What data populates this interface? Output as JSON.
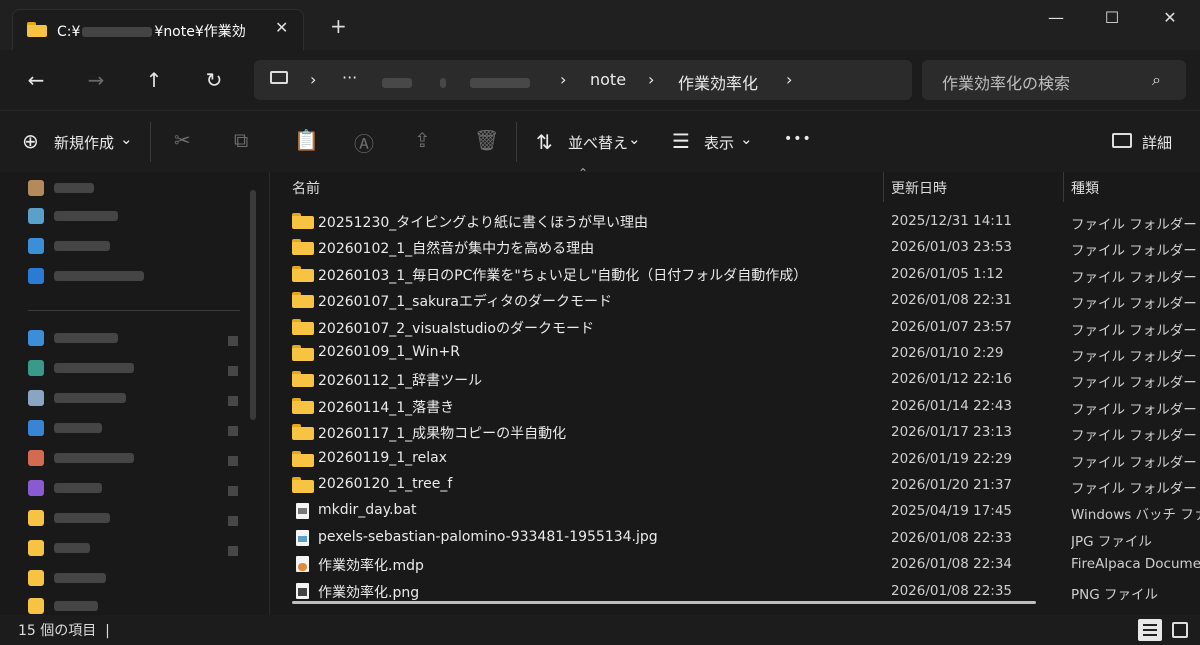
{
  "window": {
    "tab_title": "C:¥",
    "tab_title_suffix": "¥note¥作業効",
    "new_tab": "+",
    "minimize": "—",
    "maximize": "☐",
    "close": "✕",
    "tab_close": "✕"
  },
  "nav": {
    "back": "←",
    "forward": "→",
    "up": "↑",
    "refresh": "↻",
    "computer_icon": "monitor-icon",
    "ellipsis": "···",
    "crumbs": [
      "note",
      "作業効率化"
    ],
    "sep": "›"
  },
  "search": {
    "placeholder": "作業効率化の検索",
    "icon": "⌕"
  },
  "toolbar": {
    "new_label": "新規作成",
    "new_icon": "⊕",
    "sort_label": "並べ替え",
    "view_label": "表示",
    "more": "•••",
    "details_label": "詳細",
    "chevron": "⌄"
  },
  "columns": {
    "name": "名前",
    "modified": "更新日時",
    "type": "種類"
  },
  "files": [
    {
      "name": "20251230_タイピングより紙に書くほうが早い理由",
      "date": "2025/12/31 14:11",
      "type": "ファイル フォルダー",
      "kind": "folder"
    },
    {
      "name": "20260102_1_自然音が集中力を高める理由",
      "date": "2026/01/03 23:53",
      "type": "ファイル フォルダー",
      "kind": "folder"
    },
    {
      "name": "20260103_1_毎日のPC作業を\"ちょい足し\"自動化（日付フォルダ自動作成）",
      "date": "2026/01/05 1:12",
      "type": "ファイル フォルダー",
      "kind": "folder"
    },
    {
      "name": "20260107_1_sakuraエディタのダークモード",
      "date": "2026/01/08 22:31",
      "type": "ファイル フォルダー",
      "kind": "folder"
    },
    {
      "name": "20260107_2_visualstudioのダークモード",
      "date": "2026/01/07 23:57",
      "type": "ファイル フォルダー",
      "kind": "folder"
    },
    {
      "name": "20260109_1_Win+R",
      "date": "2026/01/10 2:29",
      "type": "ファイル フォルダー",
      "kind": "folder"
    },
    {
      "name": "20260112_1_辞書ツール",
      "date": "2026/01/12 22:16",
      "type": "ファイル フォルダー",
      "kind": "folder"
    },
    {
      "name": "20260114_1_落書き",
      "date": "2026/01/14 22:43",
      "type": "ファイル フォルダー",
      "kind": "folder"
    },
    {
      "name": "20260117_1_成果物コピーの半自動化",
      "date": "2026/01/17 23:13",
      "type": "ファイル フォルダー",
      "kind": "folder"
    },
    {
      "name": "20260119_1_relax",
      "date": "2026/01/19 22:29",
      "type": "ファイル フォルダー",
      "kind": "folder"
    },
    {
      "name": "20260120_1_tree_f",
      "date": "2026/01/20 21:37",
      "type": "ファイル フォルダー",
      "kind": "folder"
    },
    {
      "name": "mkdir_day.bat",
      "date": "2025/04/19 17:45",
      "type": "Windows バッチ ファイル",
      "kind": "bat"
    },
    {
      "name": "pexels-sebastian-palomino-933481-1955134.jpg",
      "date": "2026/01/08 22:33",
      "type": "JPG ファイル",
      "kind": "jpg"
    },
    {
      "name": "作業効率化.mdp",
      "date": "2026/01/08 22:34",
      "type": "FireAlpaca Document",
      "kind": "mdp"
    },
    {
      "name": "作業効率化.png",
      "date": "2026/01/08 22:35",
      "type": "PNG ファイル",
      "kind": "png"
    }
  ],
  "status": {
    "count_text": "15 個の項目",
    "cursor": "|"
  },
  "colors": {
    "folder": "#f6c343",
    "background": "#191919",
    "accent": "#4cc2ff"
  }
}
